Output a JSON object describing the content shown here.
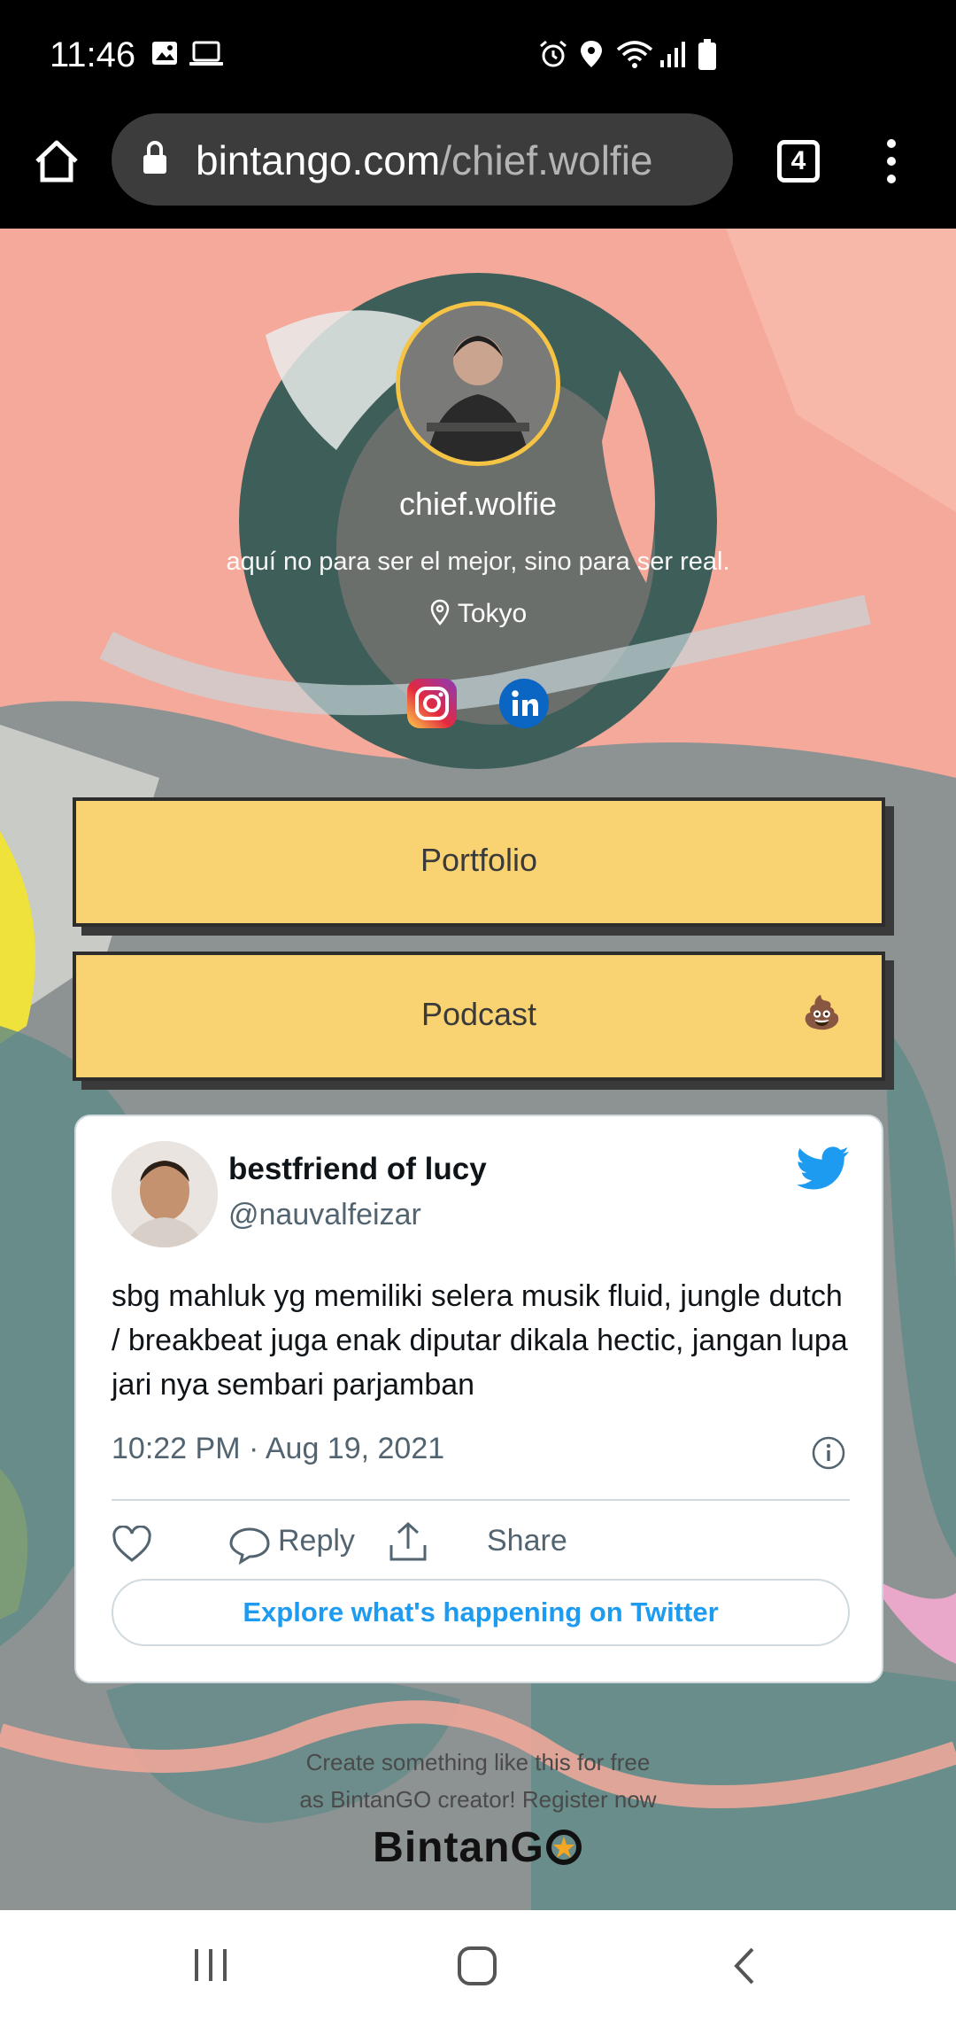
{
  "status_bar": {
    "time": "11:46",
    "left_icons": [
      "gallery-icon",
      "laptop-icon"
    ],
    "right_icons": [
      "alarm-icon",
      "location-icon",
      "wifi-icon",
      "signal-icon",
      "battery-icon"
    ]
  },
  "browser": {
    "url_domain": "bintango.com",
    "url_path": "/chief.wolfie",
    "tab_count": "4"
  },
  "profile": {
    "name": "chief.wolfie",
    "bio": "aquí no para ser el mejor, sino para ser real.",
    "location": "Tokyo",
    "social_links": [
      "instagram-icon",
      "linkedin-icon"
    ]
  },
  "links": [
    {
      "label": "Portfolio"
    },
    {
      "label": "Podcast",
      "emoji": "💩"
    }
  ],
  "tweet": {
    "display_name": "bestfriend of lucy",
    "handle": "@nauvalfeizar",
    "body": "sbg mahluk yg memiliki selera musik fluid, jungle dutch / breakbeat juga enak diputar dikala hectic, jangan lupa jari nya sembari parjamban",
    "timestamp": "10:22 PM · Aug 19, 2021",
    "reply_label": "Reply",
    "share_label": "Share",
    "explore_label": "Explore what's happening on Twitter"
  },
  "footer": {
    "line1": "Create something like this for free",
    "line2": "as BintanGO creator! Register now",
    "brand": "BintanG"
  },
  "colors": {
    "button_fill": "#f9d371",
    "avatar_ring": "#f6c445",
    "twitter_blue": "#1d9bf0",
    "paint_pink": "#f4a99a",
    "paint_teal": "#5a8f8a"
  }
}
